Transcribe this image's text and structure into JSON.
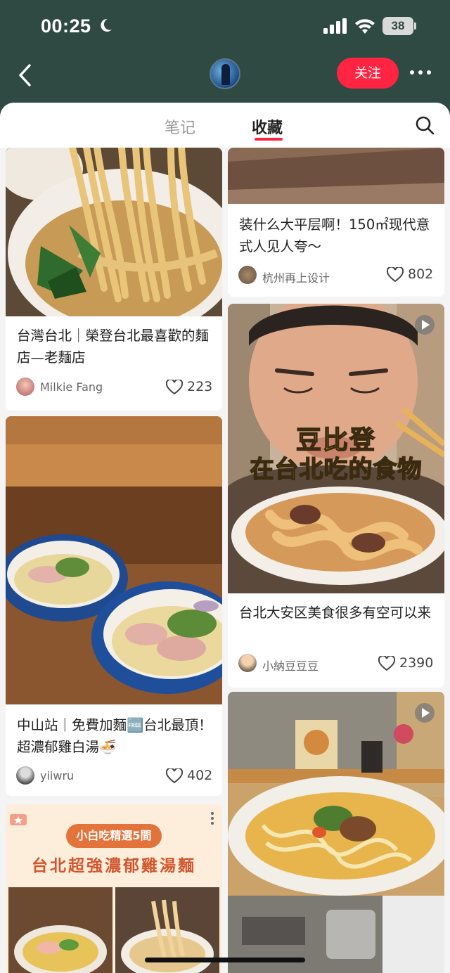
{
  "status_bar": {
    "time": "00:25",
    "battery": "38"
  },
  "nav": {
    "follow_label": "关注"
  },
  "tabs": [
    {
      "label": "笔记",
      "active": false
    },
    {
      "label": "收藏",
      "active": true
    }
  ],
  "cards": [
    {
      "title": "台灣台北｜榮登台北最喜歡的麵店—老麵店",
      "author": "Milkie Fang",
      "likes": "223"
    },
    {
      "title": "中山站｜免費加麵🆓台北最頂！超濃郁雞白湯🍜",
      "author": "yiiwru",
      "likes": "402"
    },
    {
      "title": "",
      "badge": "小白吃精選5間",
      "headline": "台北超強濃郁雞湯麵"
    },
    {
      "title": "装什么大平层啊！150㎡现代意式人见人夸～",
      "author": "杭州再上设计",
      "likes": "802"
    },
    {
      "title": "台北大安区美食很多有空可以来",
      "author": "小納豆豆豆",
      "likes": "2390",
      "overlay_line1": "豆比登",
      "overlay_line2": "在台北吃的食物"
    },
    {
      "title": ""
    }
  ],
  "icons": {
    "back": "chevron-left-icon",
    "more": "more-dots-icon",
    "search": "search-icon",
    "heart": "heart-icon",
    "play": "play-icon"
  },
  "colors": {
    "accent": "#ff2442",
    "header_bg": "#2e4a42"
  }
}
